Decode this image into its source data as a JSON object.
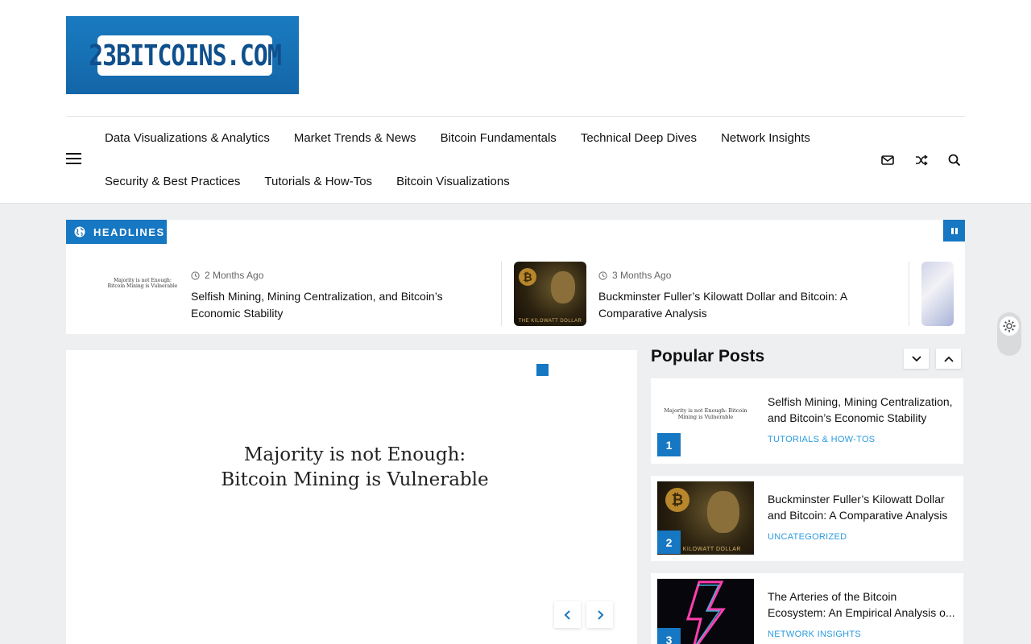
{
  "site": {
    "logo_text": "23BITCOINS.COM"
  },
  "nav": {
    "row1": [
      "Data Visualizations & Analytics",
      "Market Trends & News",
      "Bitcoin Fundamentals",
      "Technical Deep Dives",
      "Network Insights"
    ],
    "row2": [
      "Security & Best Practices",
      "Tutorials & How-Tos",
      "Bitcoin Visualizations"
    ]
  },
  "headlines": {
    "label": "HEADLINES",
    "items": [
      {
        "time": "2 Months Ago",
        "title": "Selfish Mining, Mining Centralization, and Bitcoin’s Economic Stability",
        "thumb_text": "Majority is not Enough: Bitcoin Mining is Vulnerable"
      },
      {
        "time": "3 Months Ago",
        "title": "Buckminster Fuller’s Kilowatt Dollar and Bitcoin: A Comparative Analysis",
        "thumb_text": "THE KILOWATT DOLLAR"
      }
    ]
  },
  "featured": {
    "line1": "Majority is not Enough:",
    "line2": "Bitcoin Mining is Vulnerable"
  },
  "popular": {
    "title": "Popular Posts",
    "posts": [
      {
        "num": "1",
        "title": "Selfish Mining, Mining Centralization, and Bitcoin’s Economic Stability",
        "category": "TUTORIALS & HOW-TOS",
        "thumb_text": "Majority is not Enough: Bitcoin Mining is Vulnerable"
      },
      {
        "num": "2",
        "title": "Buckminster Fuller’s Kilowatt Dollar and Bitcoin: A Comparative Analysis",
        "category": "UNCATEGORIZED",
        "thumb_text": "KILOWATT DOLLAR"
      },
      {
        "num": "3",
        "title": "The Arteries of the Bitcoin Ecosystem: An Empirical Analysis o...",
        "category": "NETWORK INSIGHTS"
      }
    ]
  },
  "colors": {
    "accent": "#1677c2",
    "category": "#2a9be0"
  }
}
